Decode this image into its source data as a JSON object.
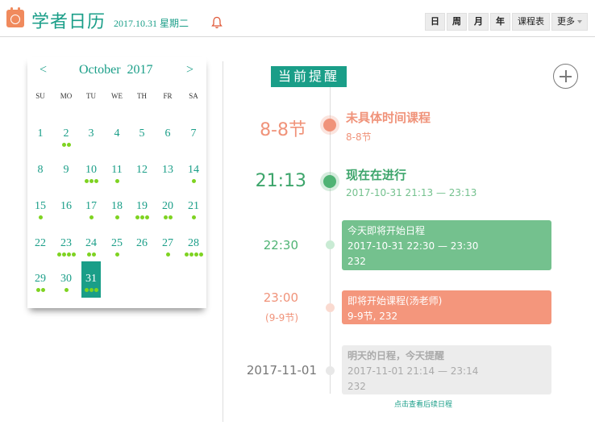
{
  "header": {
    "title": "学者日历",
    "date": "2017.10.31 星期二",
    "views": [
      "日",
      "周",
      "月",
      "年"
    ],
    "schedule": "课程表",
    "more": "更多"
  },
  "calendar": {
    "prev": "<",
    "next": ">",
    "month": "October  2017",
    "weekdays": [
      "SU",
      "MO",
      "TU",
      "WE",
      "TH",
      "FR",
      "SA"
    ],
    "selected_day": 31,
    "weeks": [
      [
        {
          "d": "1",
          "dots": 0
        },
        {
          "d": "2",
          "dots": 2
        },
        {
          "d": "3",
          "dots": 0
        },
        {
          "d": "4",
          "dots": 0
        },
        {
          "d": "5",
          "dots": 0
        },
        {
          "d": "6",
          "dots": 0
        },
        {
          "d": "7",
          "dots": 0
        }
      ],
      [
        {
          "d": "8",
          "dots": 0
        },
        {
          "d": "9",
          "dots": 0
        },
        {
          "d": "10",
          "dots": 3
        },
        {
          "d": "11",
          "dots": 1
        },
        {
          "d": "12",
          "dots": 0
        },
        {
          "d": "13",
          "dots": 0
        },
        {
          "d": "14",
          "dots": 1
        }
      ],
      [
        {
          "d": "15",
          "dots": 1
        },
        {
          "d": "16",
          "dots": 0
        },
        {
          "d": "17",
          "dots": 1
        },
        {
          "d": "18",
          "dots": 1
        },
        {
          "d": "19",
          "dots": 3
        },
        {
          "d": "20",
          "dots": 2
        },
        {
          "d": "21",
          "dots": 1
        }
      ],
      [
        {
          "d": "22",
          "dots": 0
        },
        {
          "d": "23",
          "dots": 4
        },
        {
          "d": "24",
          "dots": 2
        },
        {
          "d": "25",
          "dots": 1
        },
        {
          "d": "26",
          "dots": 0
        },
        {
          "d": "27",
          "dots": 1
        },
        {
          "d": "28",
          "dots": 4
        }
      ],
      [
        {
          "d": "29",
          "dots": 2
        },
        {
          "d": "30",
          "dots": 1
        },
        {
          "d": "31",
          "dots": 3
        }
      ]
    ]
  },
  "timeline": {
    "badge": "当前提醒",
    "events": [
      {
        "time": "8-8节",
        "title": "未具体时间课程",
        "sub": "8-8节"
      },
      {
        "time": "21:13",
        "title": "现在在进行",
        "sub": "2017-10-31 21:13 — 23:13"
      },
      {
        "time": "22:30",
        "title": "今天即将开始日程",
        "sub": "2017-10-31 22:30 — 23:30",
        "extra": "232"
      },
      {
        "time": "23:00",
        "time2": "(9-9节)",
        "title": "即将开始课程(汤老师)",
        "sub": "9-9节, 232"
      },
      {
        "time": "2017-11-01",
        "title": "明天的日程，今天提醒",
        "sub": "2017-11-01 21:14 — 23:14",
        "extra": "232"
      }
    ],
    "more_link": "点击查看后续日程"
  },
  "colors": {
    "primary": "#1a9e88",
    "salmon": "#f0937a",
    "green_card": "#74c18e",
    "gray_card": "#ececec",
    "dot": "#7ed321"
  }
}
